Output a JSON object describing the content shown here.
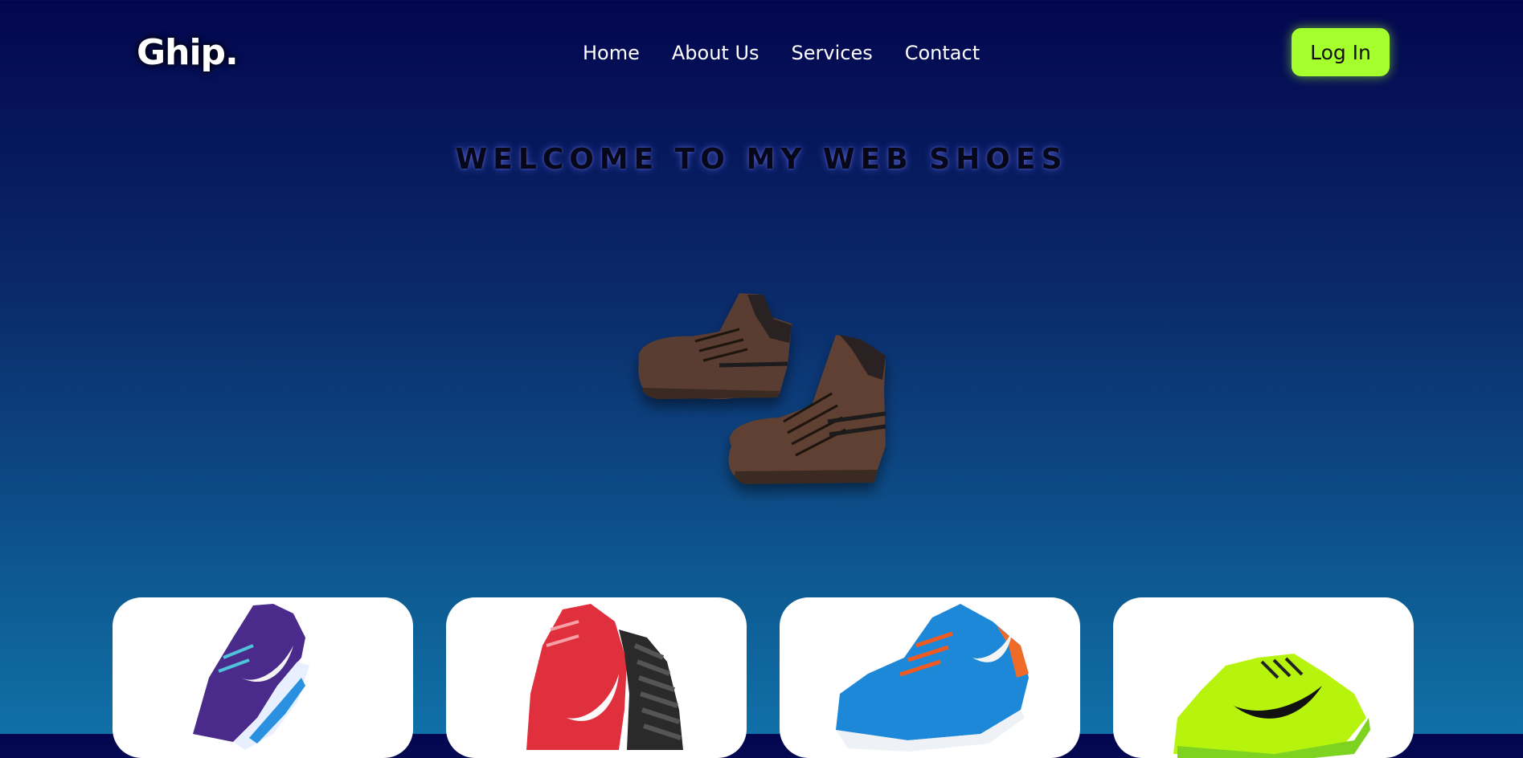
{
  "header": {
    "logo": "Ghip.",
    "nav": [
      "Home",
      "About Us",
      "Services",
      "Contact"
    ],
    "login_label": "Log In",
    "accent_color": "#a5ff2c"
  },
  "hero": {
    "headline": "WELCOME TO MY WEB SHOES",
    "image": "brown-high-top-shoes"
  },
  "products": [
    {
      "image": "purple-running-shoe",
      "color": "#4a2a8a"
    },
    {
      "image": "red-running-shoe",
      "color": "#e0303e"
    },
    {
      "image": "blue-running-shoe",
      "color": "#1e88d8"
    },
    {
      "image": "neon-green-running-shoe",
      "color": "#b6f40e"
    }
  ]
}
